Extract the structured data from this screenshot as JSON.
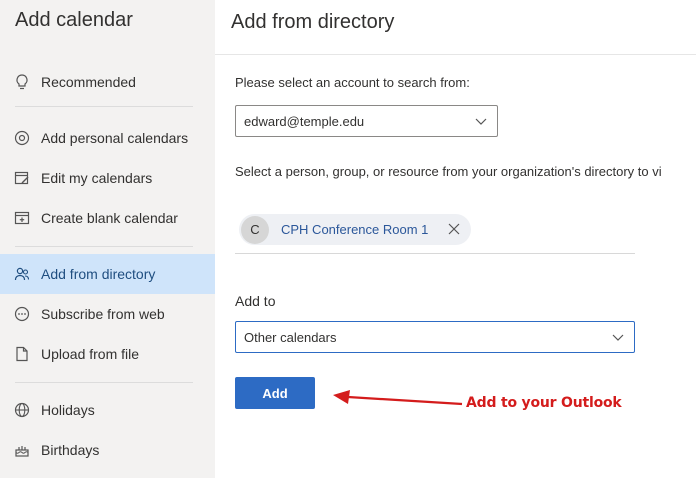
{
  "sidebar": {
    "title": "Add calendar",
    "items": [
      {
        "label": "Recommended",
        "icon": "lightbulb-icon"
      },
      {
        "label": "Add personal calendars",
        "icon": "at-sign-icon"
      },
      {
        "label": "Edit my calendars",
        "icon": "edit-calendar-icon"
      },
      {
        "label": "Create blank calendar",
        "icon": "calendar-add-icon"
      },
      {
        "label": "Add from directory",
        "icon": "people-icon",
        "active": true
      },
      {
        "label": "Subscribe from web",
        "icon": "globe-dots-icon"
      },
      {
        "label": "Upload from file",
        "icon": "file-upload-icon"
      },
      {
        "label": "Holidays",
        "icon": "globe-icon"
      },
      {
        "label": "Birthdays",
        "icon": "cake-icon"
      }
    ]
  },
  "main": {
    "title": "Add from directory",
    "account_prompt": "Please select an account to search from:",
    "account_value": "edward@temple.edu",
    "directory_prompt": "Select a person, group, or resource from your organization's directory to vi",
    "chip": {
      "initial": "C",
      "label": "CPH Conference Room 1"
    },
    "add_to_label": "Add to",
    "add_to_value": "Other calendars",
    "add_button": "Add"
  },
  "annotation": {
    "text": "Add to your Outlook",
    "color": "#d41c1c"
  },
  "colors": {
    "accent": "#2d6bc4",
    "active_bg": "#cfe4fa",
    "sidebar_bg": "#f3f2f1"
  }
}
